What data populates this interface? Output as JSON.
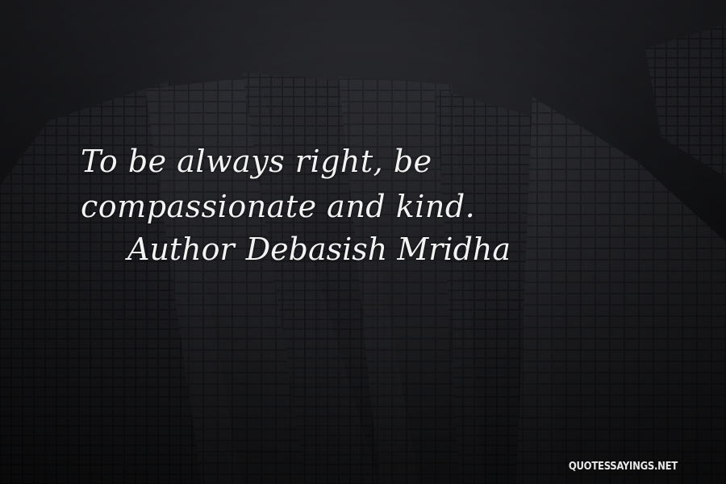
{
  "quote": {
    "text": "To be always right, be compassionate and kind."
  },
  "attribution": {
    "label": "Author",
    "name": "Debasish Mridha"
  },
  "watermark": {
    "text": "QUOTESSAYINGS.NET"
  },
  "colors": {
    "text": "#f3f3f3",
    "background": "#1d1e22",
    "building": "#3a3b40"
  }
}
